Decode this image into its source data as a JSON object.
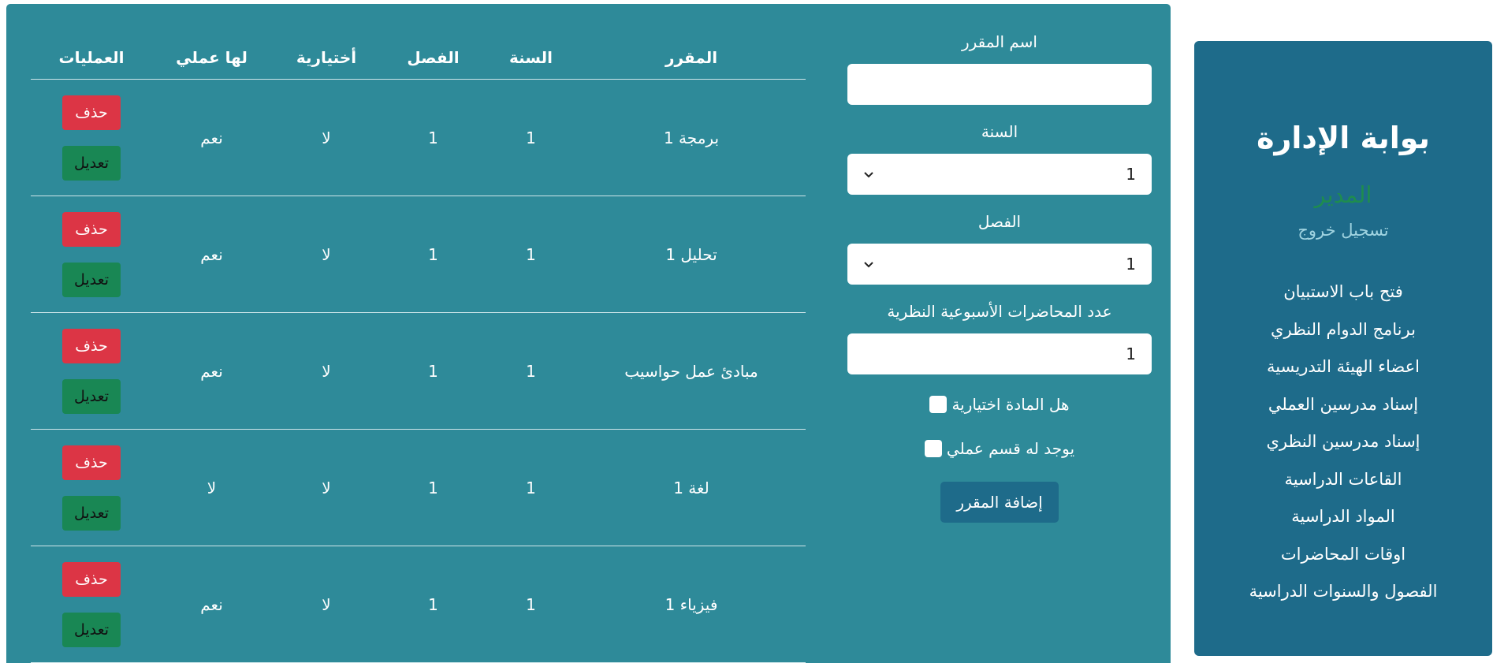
{
  "sidebar": {
    "title": "بوابة الإدارة",
    "role": "المدير",
    "logout": "تسجيل خروج",
    "items": [
      "فتح باب الاستبيان",
      "برنامج الدوام النظري",
      "اعضاء الهيئة التدريسية",
      "إسناد مدرسين العملي",
      "إسناد مدرسين النظري",
      "القاعات الدراسية",
      "المواد الدراسية",
      "اوقات المحاضرات",
      "الفصول والسنوات الدراسية"
    ]
  },
  "form": {
    "course_name_label": "اسم المقرر",
    "course_name_value": "",
    "year_label": "السنة",
    "year_value": "1",
    "term_label": "الفصل",
    "term_value": "1",
    "lectures_label": "عدد المحاضرات الأسبوعية النظرية",
    "lectures_value": "1",
    "elective_label": "هل المادة اختيارية",
    "practical_label": "يوجد له قسم عملي",
    "submit_label": "إضافة المقرر"
  },
  "table": {
    "headers": {
      "course": "المقرر",
      "year": "السنة",
      "term": "الفصل",
      "elective": "أختيارية",
      "practical": "لها عملي",
      "ops": "العمليات"
    },
    "delete_label": "حذف",
    "edit_label": "تعديل",
    "rows": [
      {
        "course": "برمجة 1",
        "year": "1",
        "term": "1",
        "elective": "لا",
        "practical": "نعم"
      },
      {
        "course": "تحليل 1",
        "year": "1",
        "term": "1",
        "elective": "لا",
        "practical": "نعم"
      },
      {
        "course": "مبادئ عمل حواسيب",
        "year": "1",
        "term": "1",
        "elective": "لا",
        "practical": "نعم"
      },
      {
        "course": "لغة 1",
        "year": "1",
        "term": "1",
        "elective": "لا",
        "practical": "لا"
      },
      {
        "course": "فيزياء 1",
        "year": "1",
        "term": "1",
        "elective": "لا",
        "practical": "نعم"
      }
    ]
  },
  "colors": {
    "main_bg": "#2e8a99",
    "sidebar_bg": "#1e6b8a",
    "role_green": "#1e8c4f",
    "delete_red": "#dc3545",
    "edit_green": "#198754"
  }
}
